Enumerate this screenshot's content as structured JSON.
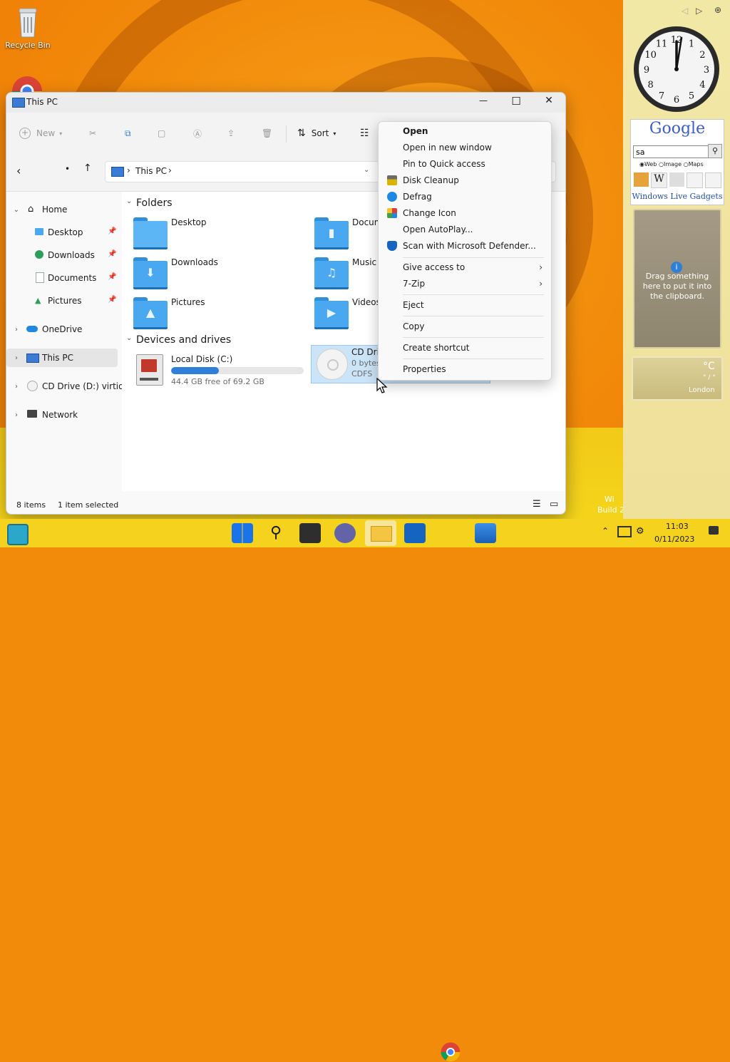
{
  "desktop": {
    "recycle_bin_label": "Recycle Bin"
  },
  "window": {
    "title": "This PC",
    "controls": {
      "minimize": "—",
      "maximize": "☐",
      "close": "✕"
    }
  },
  "toolbar": {
    "new_label": "New",
    "sort_label": "Sort"
  },
  "address": {
    "path_label": "This PC",
    "chevron": "›"
  },
  "nav": {
    "items": [
      {
        "label": "Home"
      },
      {
        "label": "Desktop"
      },
      {
        "label": "Downloads"
      },
      {
        "label": "Documents"
      },
      {
        "label": "Pictures"
      },
      {
        "label": "OneDrive"
      },
      {
        "label": "This PC"
      },
      {
        "label": "CD Drive (D:) virtio-v"
      },
      {
        "label": "Network"
      }
    ]
  },
  "content": {
    "folders_heading": "Folders",
    "folders": [
      {
        "label": "Desktop"
      },
      {
        "label": "Docum"
      },
      {
        "label": "Downloads"
      },
      {
        "label": "Music"
      },
      {
        "label": "Pictures"
      },
      {
        "label": "Videos"
      }
    ],
    "drives_heading": "Devices and drives",
    "drives": [
      {
        "label": "Local Disk (C:)",
        "free_text": "44.4 GB free of 69.2 GB",
        "used_fraction": 0.36
      },
      {
        "label": "CD Drive",
        "line2": "0 bytes",
        "line3": "CDFS"
      }
    ]
  },
  "status": {
    "items_count": "8 items",
    "selected": "1 item selected"
  },
  "context_menu": {
    "items": [
      {
        "label": "Open",
        "bold": true
      },
      {
        "label": "Open in new window"
      },
      {
        "label": "Pin to Quick access"
      },
      {
        "label": "Disk Cleanup"
      },
      {
        "label": "Defrag"
      },
      {
        "label": "Change Icon"
      },
      {
        "label": "Open AutoPlay..."
      },
      {
        "label": "Scan with Microsoft Defender..."
      },
      {
        "label": "Give access to"
      },
      {
        "label": "7-Zip"
      },
      {
        "label": "Eject"
      },
      {
        "label": "Copy"
      },
      {
        "label": "Create shortcut"
      },
      {
        "label": "Properties"
      }
    ],
    "submenu_arrow": "›"
  },
  "gadgets": {
    "google_logo": "Google",
    "search_value": "sa",
    "search_options": [
      "Web",
      "Image",
      "Maps"
    ],
    "live_gadgets_label": "Windows Live Gadgets",
    "clipboard_text": "Drag something here to put it into the clipboard.",
    "weather_temp": "°C",
    "weather_range": "° / °",
    "weather_city": "London",
    "clock_numbers": [
      "12",
      "1",
      "2",
      "3",
      "4",
      "5",
      "6",
      "7",
      "8",
      "9",
      "10",
      "11"
    ]
  },
  "watermark": {
    "line1": "Wi",
    "line2": "Build 2"
  },
  "taskbar": {
    "time": "11:03",
    "date": "0/11/2023"
  },
  "colors": {
    "accent": "#0067c0",
    "progress": "#2f7fd8",
    "selection": "#cce4f7",
    "taskbar": "#f4d21d"
  }
}
